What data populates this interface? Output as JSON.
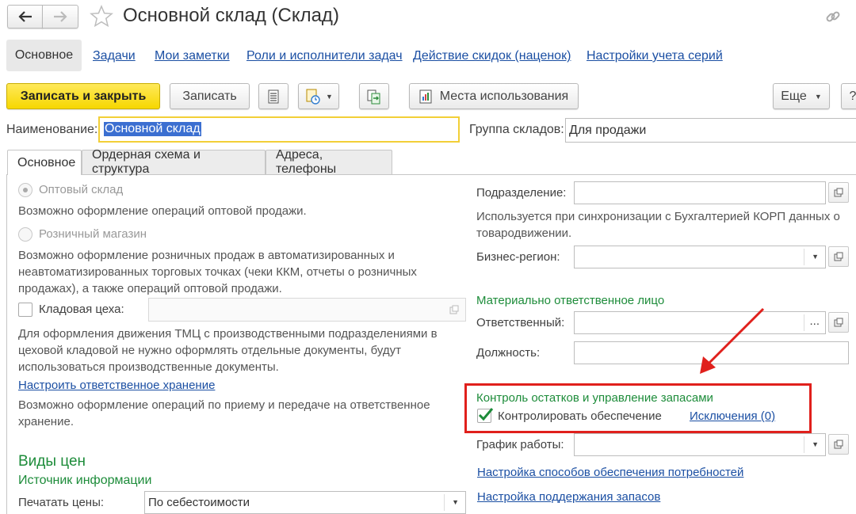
{
  "window": {
    "title": "Основной склад (Склад)"
  },
  "nav": {
    "items": [
      "Основное",
      "Задачи",
      "Мои заметки",
      "Роли и исполнители задач",
      "Действие скидок (наценок)",
      "Настройки учета серий"
    ]
  },
  "toolbar": {
    "save_close": "Записать и закрыть",
    "save": "Записать",
    "usage": "Места использования",
    "more": "Еще",
    "help": "?"
  },
  "header": {
    "name_label": "Наименование:",
    "name_value": "Основной склад",
    "group_label": "Группа складов:",
    "group_value": "Для продажи"
  },
  "tabs": [
    "Основное",
    "Ордерная схема и структура",
    "Адреса, телефоны"
  ],
  "left": {
    "wholesale_label": "Оптовый склад",
    "wholesale_hint": "Возможно оформление операций оптовой продажи.",
    "retail_label": "Розничный магазин",
    "retail_hint": "Возможно оформление розничных продаж в автоматизированных и неавтоматизированных торговых точках (чеки ККМ, отчеты о розничных продажах), а также операций оптовой продажи.",
    "workshop_label": "Кладовая цеха:",
    "workshop_hint": "Для оформления движения ТМЦ с производственными подразделениями в цеховой кладовой не нужно оформлять отдельные документы, будут использоваться производственные документы.",
    "custody_link": "Настроить ответственное хранение",
    "custody_hint": "Возможно оформление операций по приему и передаче на ответственное хранение.",
    "price_types_title": "Виды цен",
    "info_source_title": "Источник информации",
    "print_prices_label": "Печатать цены:",
    "print_prices_value": "По себестоимости"
  },
  "right": {
    "division_label": "Подразделение:",
    "division_hint": "Используется при синхронизации с Бухгалтерией КОРП данных о товародвижении.",
    "region_label": "Бизнес-регион:",
    "mol_title": "Материально ответственное лицо",
    "responsible_label": "Ответственный:",
    "position_label": "Должность:",
    "stock_control_title": "Контроль остатков и управление запасами",
    "control_supply_label": "Контролировать обеспечение",
    "exceptions_link": "Исключения (0)",
    "schedule_label": "График работы:",
    "supply_methods_link": "Настройка способов обеспечения потребностей",
    "stock_support_link": "Настройка поддержания запасов"
  },
  "colors": {
    "accent_yellow": "#f6d700",
    "link_blue": "#1b4fa3",
    "group_green": "#1d8c3a",
    "annotation_red": "#e0201c"
  }
}
